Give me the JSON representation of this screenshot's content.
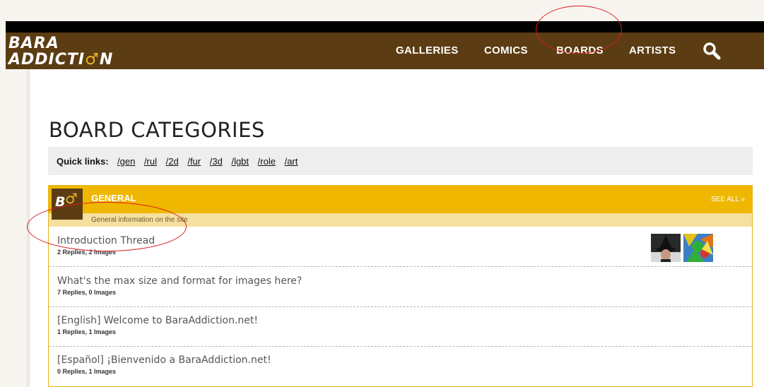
{
  "header": {
    "logo_line1": "BARA",
    "logo_line2": "ADDICTI",
    "logo_line2_end": "N",
    "nav": [
      "GALLERIES",
      "COMICS",
      "BOARDS",
      "ARTISTS"
    ]
  },
  "page": {
    "title": "BOARD CATEGORIES"
  },
  "quick_links": {
    "label": "Quick links:",
    "links": [
      "/gen",
      "/rul",
      "/2d",
      "/fur",
      "/3d",
      "/lgbt",
      "/role",
      "/art"
    ]
  },
  "board": {
    "logo_text": "B",
    "title": "GENERAL",
    "see_all": "SEE ALL »",
    "description": "General information on the site",
    "threads": [
      {
        "title": "Introduction Thread",
        "meta": "2 Replies, 2 Images"
      },
      {
        "title": "What's the max size and format for images here?",
        "meta": "7 Replies, 0 Images"
      },
      {
        "title": "[English] Welcome to BaraAddiction.net!",
        "meta": "1 Replies, 1 Images"
      },
      {
        "title": "[Español] ¡Bienvenido a BaraAddiction.net!",
        "meta": "0 Replies, 1 Images"
      }
    ]
  },
  "colors": {
    "header_bg": "#5c3c13",
    "accent_gold": "#f0b700",
    "annotation_red": "#d81f1f"
  }
}
